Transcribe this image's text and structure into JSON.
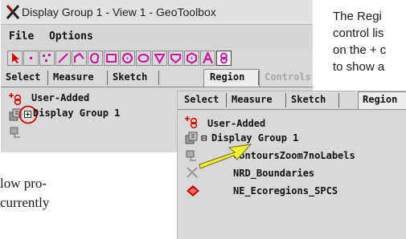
{
  "help_text": {
    "line1": "The Regi",
    "line2": "control lis",
    "line3": "on the + c",
    "line4": "to show a",
    "lower1": "low pro-",
    "lower2": "currently"
  },
  "window": {
    "title": "Display Group 1 - View 1 - GeoToolbox",
    "menu": [
      "File",
      "Options"
    ],
    "tabs": [
      "Select",
      "Measure",
      "Sketch",
      "Region",
      "Controls"
    ],
    "active_tab": "Region",
    "layers": [
      "User-Added",
      "Display Group 1"
    ]
  },
  "zoom_panel": {
    "tabs": [
      "Select",
      "Measure",
      "Sketch",
      "Region"
    ],
    "active_tab": "Region",
    "group_name": "Display Group 1",
    "user_added": "User-Added",
    "group_expanded_marker": "⊟",
    "layers": [
      "ContoursZoom7noLabels",
      "NRD_Boundaries",
      "NE_Ecoregions_SPCS"
    ]
  },
  "colors": {
    "accent_red": "#d00000",
    "arrow_yellow": "#f2ee2e",
    "tool_magenta": "#c8109c"
  }
}
